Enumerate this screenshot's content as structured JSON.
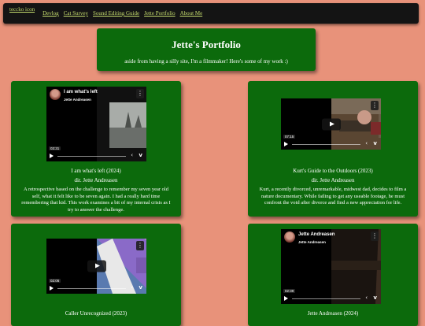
{
  "nav": {
    "logo_alt": "teccko icon",
    "links": [
      "Devlog",
      "Cat Survey",
      "Sound Editing Guide",
      "Jette Portfolio",
      "About Me"
    ]
  },
  "header": {
    "title": "Jette's Portfolio",
    "subtitle": "aside from having a silly site, I'm a filmmaker! Here's some of my work :)"
  },
  "films": [
    {
      "video_title": "I am what's left",
      "channel": "Jette Andreasen",
      "duration": "03:31",
      "title": "I am what's left (2024)",
      "director": "dir. Jette Andreasen",
      "description": "A retrospective based on the challenge to remember my seven year old self, what it felt like to be seven again. I had a really hard time remembering that kid. This work examines a bit of my internal crisis as I try to answer the challenge."
    },
    {
      "duration": "07:15",
      "title": "Kurt's Guide to the Outdoors (2023)",
      "director": "dir. Jette Andreasen",
      "description": "Kurt, a recently divorced, unremarkable, midwest dad, decides to film a nature documentary. While failing to get any useable footage, he must confront the void after divorce and find a new appreciation for life."
    },
    {
      "duration": "02:06",
      "title": "Caller Unrecognized (2023)"
    },
    {
      "video_title": "Jette Andreasen",
      "channel": "Jette Andreasen",
      "duration": "02:39",
      "title": "Jette Andreasen (2024)"
    }
  ],
  "icons": {
    "play": "play-icon",
    "more": "more-options-icon",
    "vimeo": "vimeo-icon",
    "settings": "settings-icon"
  },
  "colors": {
    "page_bg": "#e8927a",
    "card_bg": "#0c6a0c",
    "nav_bg": "#141414",
    "nav_link": "#c6dd6e"
  }
}
